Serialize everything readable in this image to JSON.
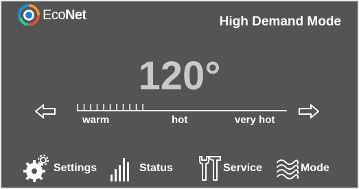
{
  "brand": {
    "eco": "Eco",
    "net": "Net"
  },
  "mode_title": "High Demand Mode",
  "temperature": "120°",
  "scale": {
    "labels": [
      "warm",
      "hot",
      "very hot"
    ],
    "level": 0.32
  },
  "icons": {
    "left_arrow": "left-arrow-icon",
    "right_arrow": "right-arrow-icon"
  },
  "menu": {
    "settings": "Settings",
    "status": "Status",
    "service": "Service",
    "mode": "Mode"
  },
  "colors": {
    "background": "#545454",
    "border": "#ededed",
    "temperature": "#c9c9c9",
    "text": "#ffffff"
  }
}
